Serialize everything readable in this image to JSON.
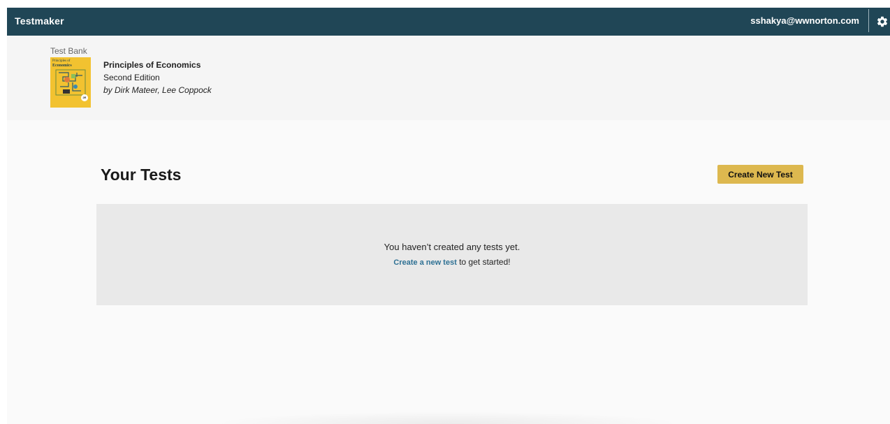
{
  "topbar": {
    "app_title": "Testmaker",
    "user_email": "sshakya@wwnorton.com",
    "settings_icon": "gear-icon",
    "background": "#204656"
  },
  "book": {
    "section_label": "Test Bank",
    "title": "Principles of Economics",
    "edition": "Second Edition",
    "authors": "by Dirk Mateer, Lee Coppock",
    "cover": {
      "title_line1": "Principles of",
      "title_line2": "Economics",
      "edition_badge": "2E",
      "color": "#f2c230"
    }
  },
  "main": {
    "heading": "Your Tests",
    "create_button_label": "Create New Test",
    "create_button_color": "#ddb84f",
    "empty_state": {
      "message": "You haven’t created any tests yet.",
      "link_text": "Create a new test",
      "after_link": " to get started!"
    }
  }
}
